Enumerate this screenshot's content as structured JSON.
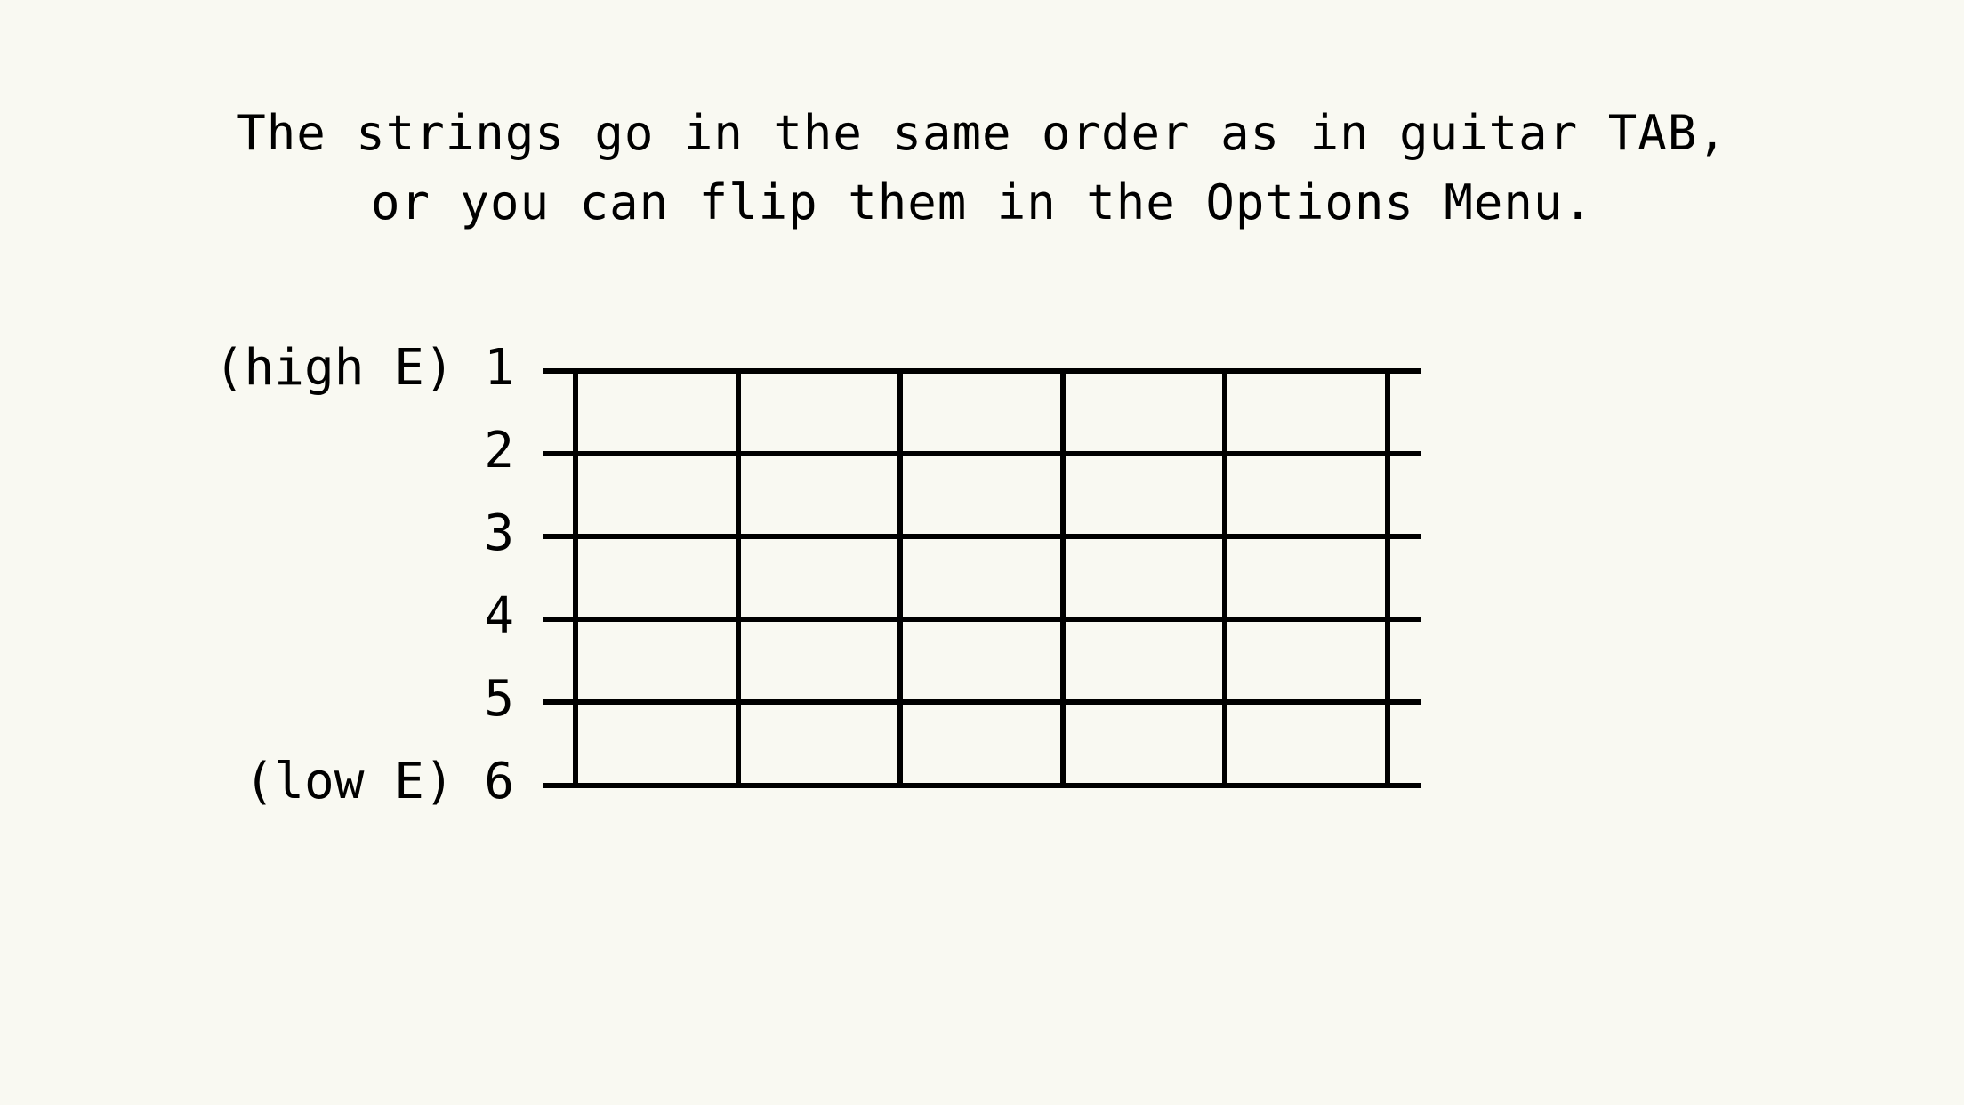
{
  "background_color": "#f9f9f2",
  "ink_color": "#000000",
  "instructions": {
    "line1": "The strings go in the same order as in guitar TAB,",
    "line2": "or you can flip them in the Options Menu."
  },
  "fretboard": {
    "string_labels": [
      "(high E) 1",
      "2",
      "3",
      "4",
      "5",
      "(low E) 6"
    ],
    "string_count": 6,
    "fret_line_count": 6
  }
}
